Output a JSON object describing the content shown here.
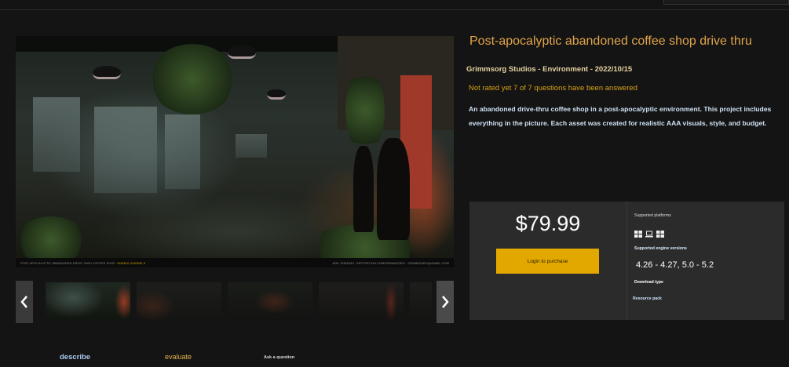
{
  "product": {
    "title": "Post-apocalyptic abandoned coffee shop drive thru",
    "meta": "Grimmsorg Studios - Environment - 2022/10/15",
    "rating": "Not rated yet 7 of 7 questions have been answered",
    "description": "An abandoned drive-thru coffee shop in a post-apocalyptic environment. This project includes everything in the picture. Each asset was created for realistic AAA visuals, style, and budget."
  },
  "hero_image": {
    "caption_left": "POST APOCALYPTIC ABANDONED DRIVE THRU COFFEE SHOP",
    "caption_highlight": "UNREAL ENGINE 5",
    "caption_right": "ARIL SOBESKI  ·  ARTSTATION.COM/GRIMMSORG  ·  GRIMMSORG@GMAIL.COM"
  },
  "gallery": {
    "prev_icon": "chevron-left-icon",
    "next_icon": "chevron-right-icon"
  },
  "purchase": {
    "price": "$79.99",
    "button_label": "Login to purchase",
    "platforms_label": "Supported platforms",
    "platform_icons": [
      "windows-icon",
      "laptop-icon",
      "windows-icon"
    ],
    "engine_label": "Supported engine versions",
    "engine_versions": "4.26 - 4.27, 5.0 - 5.2",
    "download_type_label": "Download type",
    "download_type_value": "Resource pack"
  },
  "tabs": {
    "describe": "describe",
    "evaluate": "evaluate",
    "ask": "Ask a question"
  },
  "colors": {
    "background": "#141414",
    "accent": "#e3a800",
    "title": "#e0a44a",
    "panel": "#2b2b2c"
  }
}
